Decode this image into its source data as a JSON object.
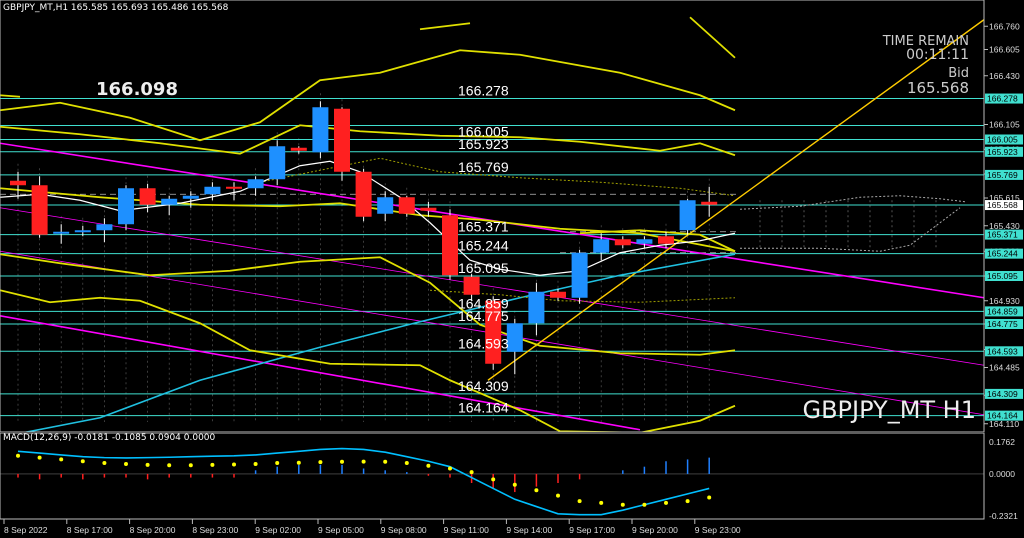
{
  "header": {
    "symbol_line": "GBPJPY_MT,H1  165.585 165.693 165.486 165.568",
    "macd_line": "MACD(12,26,9) -0.0181 -0.1085 0.0904 0.0000"
  },
  "info": {
    "time_remain_label": "TIME REMAIN",
    "time_remain": "00:11:11",
    "bid_label": "Bid",
    "bid": "165.568",
    "watermark": "GBPJPY_MT H1",
    "big_price": "166.098"
  },
  "colors": {
    "bull": "#1e90ff",
    "bear": "#ff2020",
    "level": "#40e0d0",
    "pitchfork": "#ff00ff",
    "trendline": "#ffcc00",
    "bands": "#e0e000",
    "ma": "#ffffff",
    "macd_signal": "#ffff00",
    "macd_main": "#00bfff"
  },
  "chart_data": [
    {
      "type": "candlestick",
      "symbol": "GBPJPY_MT",
      "timeframe": "H1",
      "x_ticks": [
        "8 Sep 2022",
        "8 Sep 17:00",
        "8 Sep 20:00",
        "8 Sep 23:00",
        "9 Sep 02:00",
        "9 Sep 05:00",
        "9 Sep 08:00",
        "9 Sep 11:00",
        "9 Sep 14:00",
        "9 Sep 17:00",
        "9 Sep 20:00",
        "9 Sep 23:00"
      ],
      "y_ticks": [
        166.76,
        166.605,
        166.43,
        166.105,
        165.94,
        165.775,
        165.615,
        165.43,
        165.26,
        165.095,
        164.93,
        164.775,
        164.605,
        164.485,
        164.3,
        164.11
      ],
      "ylim": [
        164.055,
        166.935
      ],
      "levels": [
        166.278,
        166.098,
        166.005,
        165.923,
        165.769,
        165.568,
        165.371,
        165.244,
        165.095,
        164.859,
        164.775,
        164.593,
        164.309,
        164.164
      ],
      "level_labels": [
        "166.278",
        "166.005",
        "165.923",
        "165.769",
        "165.371",
        "165.244",
        "165.095",
        "164.859",
        "164.775",
        "164.593",
        "164.309",
        "164.164"
      ],
      "candles": [
        {
          "o": 165.73,
          "h": 165.79,
          "l": 165.61,
          "c": 165.7
        },
        {
          "o": 165.7,
          "h": 165.76,
          "l": 165.35,
          "c": 165.37
        },
        {
          "o": 165.38,
          "h": 165.44,
          "l": 165.31,
          "c": 165.39
        },
        {
          "o": 165.39,
          "h": 165.43,
          "l": 165.36,
          "c": 165.4
        },
        {
          "o": 165.4,
          "h": 165.48,
          "l": 165.32,
          "c": 165.44
        },
        {
          "o": 165.44,
          "h": 165.7,
          "l": 165.4,
          "c": 165.68
        },
        {
          "o": 165.68,
          "h": 165.71,
          "l": 165.52,
          "c": 165.57
        },
        {
          "o": 165.57,
          "h": 165.63,
          "l": 165.5,
          "c": 165.61
        },
        {
          "o": 165.61,
          "h": 165.66,
          "l": 165.55,
          "c": 165.63
        },
        {
          "o": 165.64,
          "h": 165.72,
          "l": 165.6,
          "c": 165.69
        },
        {
          "o": 165.69,
          "h": 165.72,
          "l": 165.6,
          "c": 165.68
        },
        {
          "o": 165.68,
          "h": 165.76,
          "l": 165.63,
          "c": 165.74
        },
        {
          "o": 165.74,
          "h": 166.0,
          "l": 165.7,
          "c": 165.96
        },
        {
          "o": 165.95,
          "h": 165.96,
          "l": 165.91,
          "c": 165.93
        },
        {
          "o": 165.92,
          "h": 166.26,
          "l": 165.88,
          "c": 166.22
        },
        {
          "o": 166.21,
          "h": 166.22,
          "l": 165.73,
          "c": 165.79
        },
        {
          "o": 165.79,
          "h": 165.81,
          "l": 165.46,
          "c": 165.49
        },
        {
          "o": 165.51,
          "h": 165.66,
          "l": 165.46,
          "c": 165.62
        },
        {
          "o": 165.62,
          "h": 165.63,
          "l": 165.49,
          "c": 165.51
        },
        {
          "o": 165.55,
          "h": 165.59,
          "l": 165.49,
          "c": 165.53
        },
        {
          "o": 165.5,
          "h": 165.54,
          "l": 165.07,
          "c": 165.1
        },
        {
          "o": 165.09,
          "h": 165.11,
          "l": 164.93,
          "c": 164.97
        },
        {
          "o": 164.93,
          "h": 164.96,
          "l": 164.47,
          "c": 164.51
        },
        {
          "o": 164.59,
          "h": 164.81,
          "l": 164.44,
          "c": 164.78
        },
        {
          "o": 164.78,
          "h": 165.05,
          "l": 164.7,
          "c": 164.99
        },
        {
          "o": 164.99,
          "h": 165.01,
          "l": 164.93,
          "c": 164.95
        },
        {
          "o": 164.95,
          "h": 165.27,
          "l": 164.91,
          "c": 165.25
        },
        {
          "o": 165.25,
          "h": 165.38,
          "l": 165.2,
          "c": 165.34
        },
        {
          "o": 165.34,
          "h": 165.36,
          "l": 165.28,
          "c": 165.3
        },
        {
          "o": 165.31,
          "h": 165.36,
          "l": 165.28,
          "c": 165.34
        },
        {
          "o": 165.36,
          "h": 165.39,
          "l": 165.28,
          "c": 165.31
        },
        {
          "o": 165.4,
          "h": 165.61,
          "l": 165.37,
          "c": 165.6
        },
        {
          "o": 165.59,
          "h": 165.69,
          "l": 165.49,
          "c": 165.57
        }
      ],
      "macd": {
        "ylim": [
          -0.2321,
          0.1762
        ],
        "y_ticks": [
          0.1762,
          0.0,
          -0.2321
        ],
        "histogram": [
          -0.02,
          -0.03,
          -0.02,
          -0.03,
          -0.02,
          -0.02,
          -0.03,
          -0.02,
          -0.02,
          -0.02,
          -0.02,
          0.02,
          0.04,
          0.05,
          0.05,
          0.05,
          0.03,
          0.02,
          0.01,
          -0.01,
          -0.02,
          -0.05,
          -0.08,
          -0.1,
          -0.07,
          -0.05,
          -0.03,
          0.0,
          0.02,
          0.04,
          0.07,
          0.08,
          0.09
        ],
        "signal": [
          0.1,
          0.09,
          0.08,
          0.07,
          0.06,
          0.055,
          0.05,
          0.048,
          0.048,
          0.05,
          0.052,
          0.055,
          0.06,
          0.062,
          0.065,
          0.067,
          0.068,
          0.067,
          0.06,
          0.045,
          0.03,
          0.01,
          -0.03,
          -0.06,
          -0.09,
          -0.12,
          -0.15,
          -0.16,
          -0.17,
          -0.17,
          -0.16,
          -0.15,
          -0.13
        ],
        "main": [
          0.125,
          0.115,
          0.105,
          0.095,
          0.09,
          0.088,
          0.09,
          0.092,
          0.095,
          0.098,
          0.1,
          0.105,
          0.115,
          0.125,
          0.135,
          0.14,
          0.135,
          0.12,
          0.095,
          0.07,
          0.04,
          -0.02,
          -0.08,
          -0.14,
          -0.18,
          -0.22,
          -0.225,
          -0.225,
          -0.2,
          -0.17,
          -0.14,
          -0.11,
          -0.08
        ]
      }
    }
  ]
}
